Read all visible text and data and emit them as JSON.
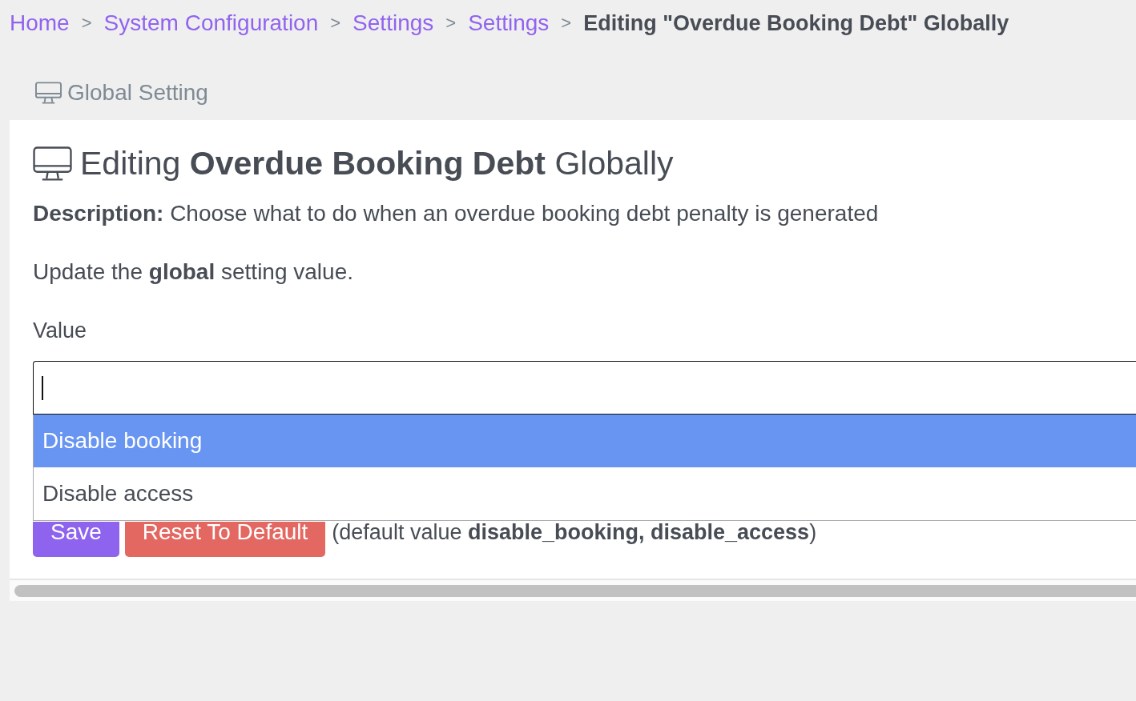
{
  "breadcrumb": [
    {
      "label": "Home",
      "kind": "link"
    },
    {
      "label": ">",
      "kind": "separator"
    },
    {
      "label": "System Configuration",
      "kind": "link"
    },
    {
      "label": ">",
      "kind": "separator"
    },
    {
      "label": "Settings",
      "kind": "link"
    },
    {
      "label": ">",
      "kind": "separator"
    },
    {
      "label": "Settings",
      "kind": "link"
    },
    {
      "label": ">",
      "kind": "separator"
    },
    {
      "label": "Editing \"Overdue Booking Debt\" Globally",
      "kind": "current"
    }
  ],
  "panel_tab": {
    "label": "Global Setting"
  },
  "card": {
    "title": "Editing **Overdue Booking Debt** Globally",
    "description": "**Description:** Choose what to do when an overdue booking debt penalty is generated",
    "instruction": "Update the **global** setting value.",
    "field": {
      "label": "Value",
      "focused": true,
      "expanded": true,
      "options": [
        {
          "label": "Disable booking",
          "selected": true
        },
        {
          "label": "Disable access",
          "selected": false
        }
      ]
    },
    "buttons": [
      {
        "label": "Save",
        "kind": "primary"
      },
      {
        "label": "Reset To Default",
        "kind": "danger"
      }
    ],
    "default_note": "(default value **disable_booking, disable_access**)"
  }
}
